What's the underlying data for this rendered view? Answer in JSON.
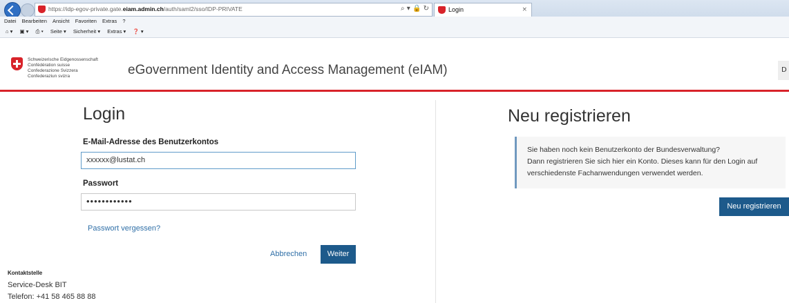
{
  "browser": {
    "url_prefix": "https://idp-egov-private.gate.",
    "url_domain": "eiam.admin.ch",
    "url_suffix": "/auth/saml2/sso/IDP-PRIVATE",
    "tab_title": "Login",
    "menu": [
      "Datei",
      "Bearbeiten",
      "Ansicht",
      "Favoriten",
      "Extras",
      "?"
    ],
    "toolbar": [
      "Seite ▾",
      "Sicherheit ▾",
      "Extras ▾"
    ]
  },
  "header": {
    "federation_lines": [
      "Schweizerische Eidgenossenschaft",
      "Confédération suisse",
      "Confederazione Svizzera",
      "Confederaziun svizra"
    ],
    "title": "eGovernment Identity and Access Management (eIAM)",
    "lang_button": "D"
  },
  "login": {
    "heading": "Login",
    "email_label": "E-Mail-Adresse des Benutzerkontos",
    "email_value": "xxxxxx@lustat.ch",
    "password_label": "Passwort",
    "password_value": "••••••••••••",
    "forgot_link": "Passwort vergessen?",
    "cancel_label": "Abbrechen",
    "submit_label": "Weiter"
  },
  "register": {
    "heading": "Neu registrieren",
    "info_line1": "Sie haben noch kein Benutzerkonto der Bundesverwaltung?",
    "info_line2": "Dann registrieren Sie sich hier ein Konto. Dieses kann für den Login auf",
    "info_line3": "verschiedenste Fachanwendungen verwendet werden.",
    "button_label": "Neu registrieren"
  },
  "contact": {
    "title": "Kontaktstelle",
    "name": "Service-Desk BIT",
    "phone": "Telefon: +41 58 465 88 88"
  }
}
